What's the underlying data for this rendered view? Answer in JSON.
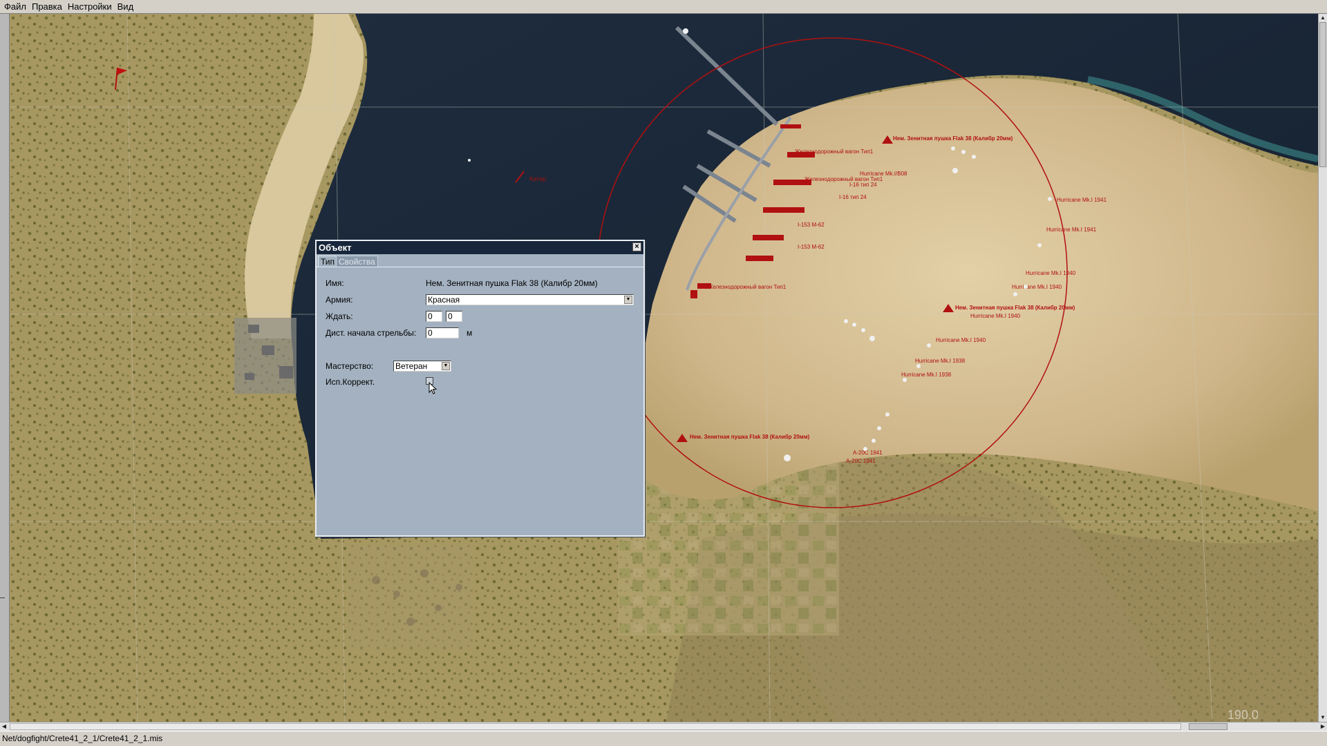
{
  "menu": [
    "Файл",
    "Правка",
    "Настройки",
    "Вид"
  ],
  "status": {
    "path": "Net/dogfight/Crete41_2_1/Crete41_2_1.mis"
  },
  "map": {
    "scale_value": "190.0"
  },
  "dialog": {
    "title": "Объект",
    "close_label": "×",
    "tabs": [
      "Тип",
      "Свойства"
    ],
    "name_label": "Имя:",
    "name_value": "Нем. Зенитная пушка Flak 38 (Калибр 20мм)",
    "army_label": "Армия:",
    "army_value": "Красная",
    "wait_label": "Ждать:",
    "wait_value_1": "0",
    "wait_value_2": "0",
    "fire_dist_label": "Дист. начала стрельбы:",
    "fire_dist_value": "0",
    "fire_dist_unit": "м",
    "skill_label": "Мастерство:",
    "skill_value": "Ветеран",
    "use_correct_label": "Исп.Коррект.",
    "use_correct_checked": false
  },
  "map_labels": {
    "flak_1": "Нем. Зенитная пушка Flak 38 (Калибр 20мм)",
    "flak_2": "Нем. Зенитная пушка Flak 38 (Калибр 20мм)",
    "flak_3": "Нем. Зенитная пушка Flak 38 (Калибр 20мм)",
    "hurricane_1": "Hurricane Mk.I 1940",
    "hurricane_2": "Hurricane Mk.I 1940",
    "hurricane_3": "Hurricane Mk.I 1938",
    "hurricane_4": "Hurricane Mk.I 1938",
    "hurricane_5": "Hurricane Mk.I 1940",
    "hurricane_6": "Hurricane Mk.I 1941",
    "hurricane_7": "Hurricane Mk.I 1941",
    "hurricane_8": "Hurricane Mk.I/B08",
    "a20_1": "A-20C 1941",
    "a20_2": "A-20C 1941",
    "i16_1": "I-16 тип 24",
    "i16_2": "I-16 тип 24",
    "i153_1": "I-153 M-62",
    "i153_2": "I-153 M-62",
    "rail_1": "Железнодорожный вагон Тип1",
    "rail_2": "Железнодорожный вагон Тип1",
    "rail_3": "Железнодорожный вагон Тип1",
    "boat": "Катер"
  },
  "colors": {
    "sea": "#1c2a3a",
    "land_sand": "#cdb88e",
    "land_olive": "#9c8c52",
    "marker_red": "#b01010",
    "dialog_bg": "#a3b1c0",
    "dialog_title": "#17263a"
  }
}
